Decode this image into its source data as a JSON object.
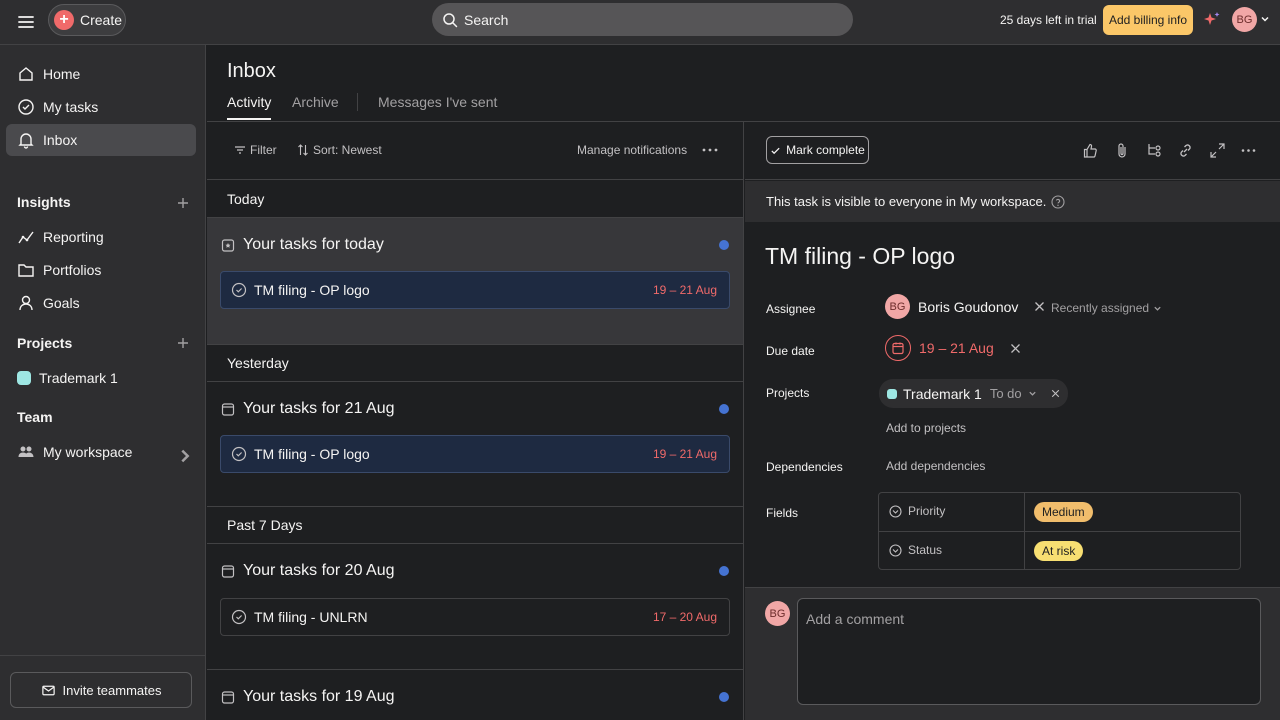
{
  "topbar": {
    "create_label": "Create",
    "search_placeholder": "Search",
    "trial_text": "25 days left in trial",
    "billing_label": "Add billing info",
    "user_initials": "BG"
  },
  "sidebar": {
    "nav": [
      {
        "label": "Home",
        "icon": "home-icon"
      },
      {
        "label": "My tasks",
        "icon": "check-circle-icon"
      },
      {
        "label": "Inbox",
        "icon": "bell-icon"
      }
    ],
    "insights_title": "Insights",
    "insights": [
      {
        "label": "Reporting",
        "icon": "reporting-icon"
      },
      {
        "label": "Portfolios",
        "icon": "folder-icon"
      },
      {
        "label": "Goals",
        "icon": "person-icon"
      }
    ],
    "projects_title": "Projects",
    "projects": [
      {
        "label": "Trademark 1",
        "color": "#9ee7e3"
      }
    ],
    "team_title": "Team",
    "team": [
      {
        "label": "My workspace",
        "icon": "team-icon"
      }
    ],
    "invite_label": "Invite teammates"
  },
  "inbox": {
    "title": "Inbox",
    "tabs": [
      "Activity",
      "Archive",
      "Messages I've sent"
    ]
  },
  "feed": {
    "filter_label": "Filter",
    "sort_label": "Sort: Newest",
    "manage_label": "Manage notifications",
    "groups": [
      {
        "heading": "Today",
        "card_title": "Your tasks for today",
        "task": "TM filing - OP logo",
        "date": "19 – 21 Aug"
      },
      {
        "heading": "Yesterday",
        "card_title": "Your tasks for 21 Aug",
        "task": "TM filing - OP logo",
        "date": "19 – 21 Aug"
      },
      {
        "heading": "Past 7 Days",
        "card_title": "Your tasks for 20 Aug",
        "task": "TM filing - UNLRN",
        "date": "17 – 20 Aug"
      },
      {
        "card_title": "Your tasks for 19 Aug"
      }
    ]
  },
  "detail": {
    "mark_complete": "Mark complete",
    "visibility": "This task is visible to everyone in My workspace.",
    "title": "TM filing - OP logo",
    "labels": {
      "assignee": "Assignee",
      "due_date": "Due date",
      "projects": "Projects",
      "dependencies": "Dependencies",
      "fields": "Fields"
    },
    "assignee_name": "Boris Goudonov",
    "assignee_initials": "BG",
    "recently_assigned": "Recently assigned",
    "due_date": "19 – 21 Aug",
    "project_name": "Trademark 1",
    "project_section": "To do",
    "add_to_projects": "Add to projects",
    "add_dependencies": "Add dependencies",
    "fields": [
      {
        "name": "Priority",
        "value": "Medium",
        "color": "#f1bd6c"
      },
      {
        "name": "Status",
        "value": "At risk",
        "color": "#f8df72"
      }
    ],
    "comment_placeholder": "Add a comment",
    "commenter_initials": "BG"
  },
  "colors": {
    "accent_red": "#f06a6a",
    "unread_dot": "#4573d2",
    "billing_button": "#fbc768"
  }
}
